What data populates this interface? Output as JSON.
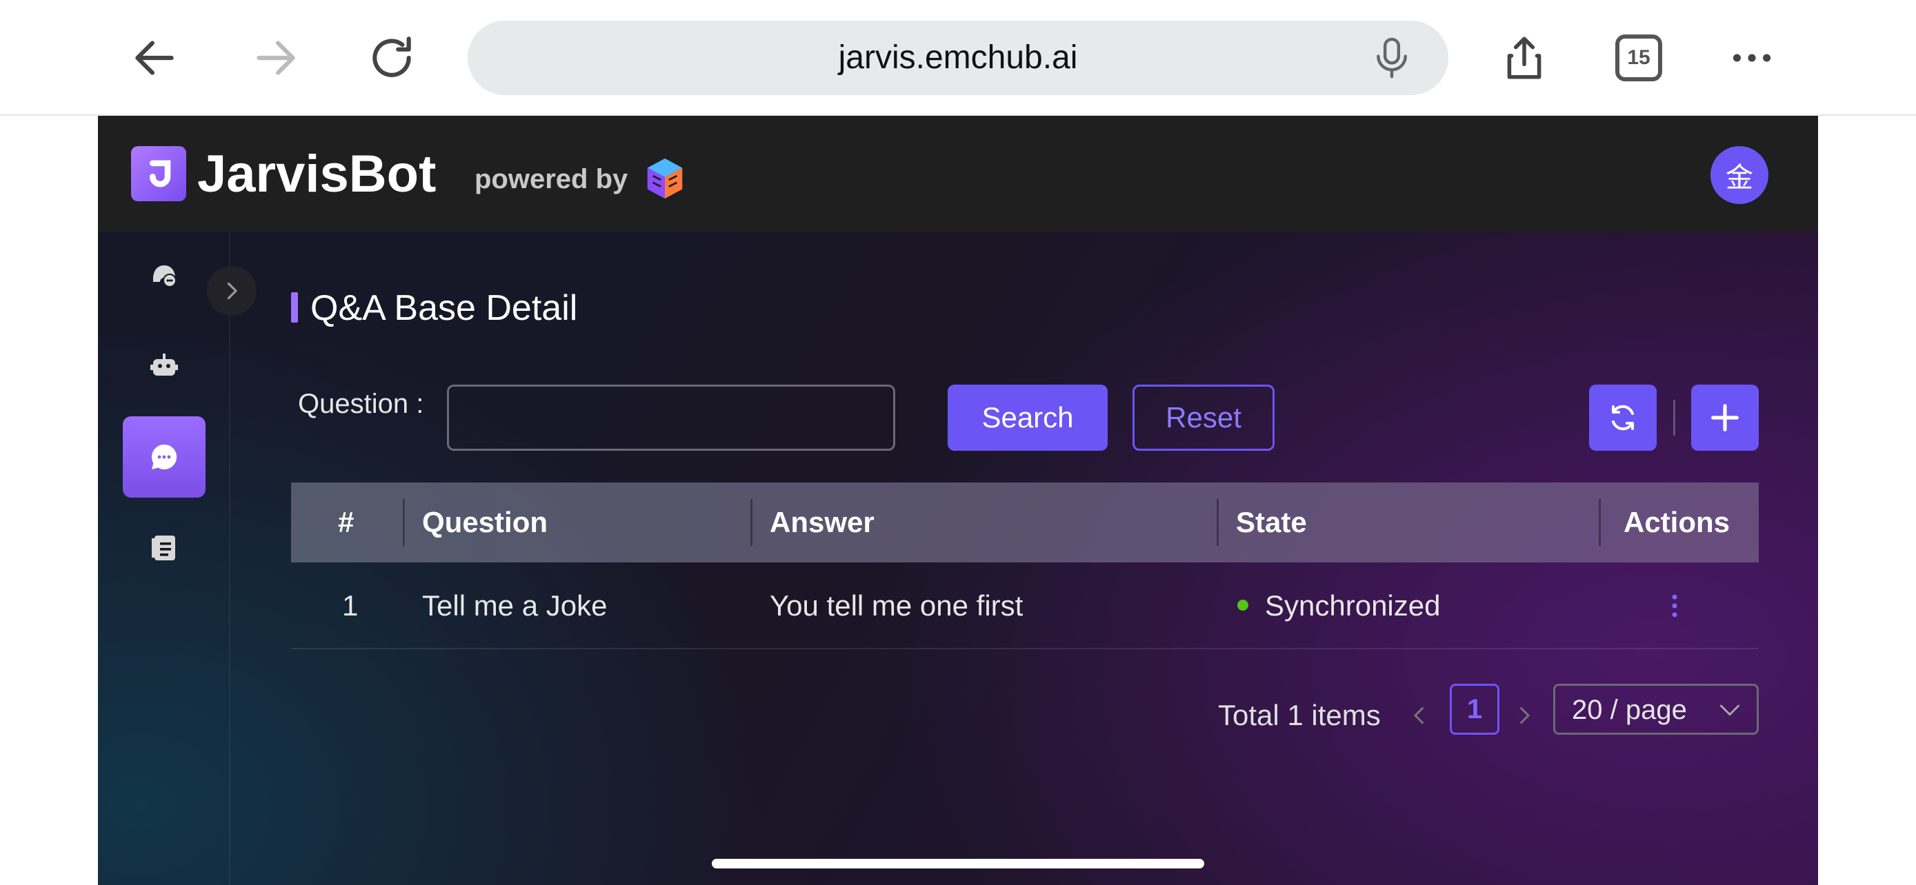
{
  "browser": {
    "url": "jarvis.emchub.ai",
    "tab_count": "15"
  },
  "header": {
    "brand": "JarvisBot",
    "powered_by": "powered by",
    "avatar_text": "金"
  },
  "sidebar": {
    "items": [
      {
        "icon": "chat-person-icon",
        "active": false
      },
      {
        "icon": "robot-icon",
        "active": false
      },
      {
        "icon": "qa-chat-bubble-icon",
        "active": true
      },
      {
        "icon": "document-list-icon",
        "active": false
      }
    ]
  },
  "page": {
    "title": "Q&A Base Detail"
  },
  "filter": {
    "question_label": "Question :",
    "question_value": "",
    "search_label": "Search",
    "reset_label": "Reset"
  },
  "table": {
    "columns": [
      "#",
      "Question",
      "Answer",
      "State",
      "Actions"
    ],
    "rows": [
      {
        "index": "1",
        "question": "Tell me a Joke",
        "answer": "You tell me one first",
        "state": "Synchronized",
        "state_color": "#52c41a"
      }
    ]
  },
  "pagination": {
    "total_text": "Total 1 items",
    "current_page": "1",
    "page_size": "20 / page"
  },
  "colors": {
    "accent": "#6b55f5",
    "header_bg": "#1f1f1f"
  }
}
